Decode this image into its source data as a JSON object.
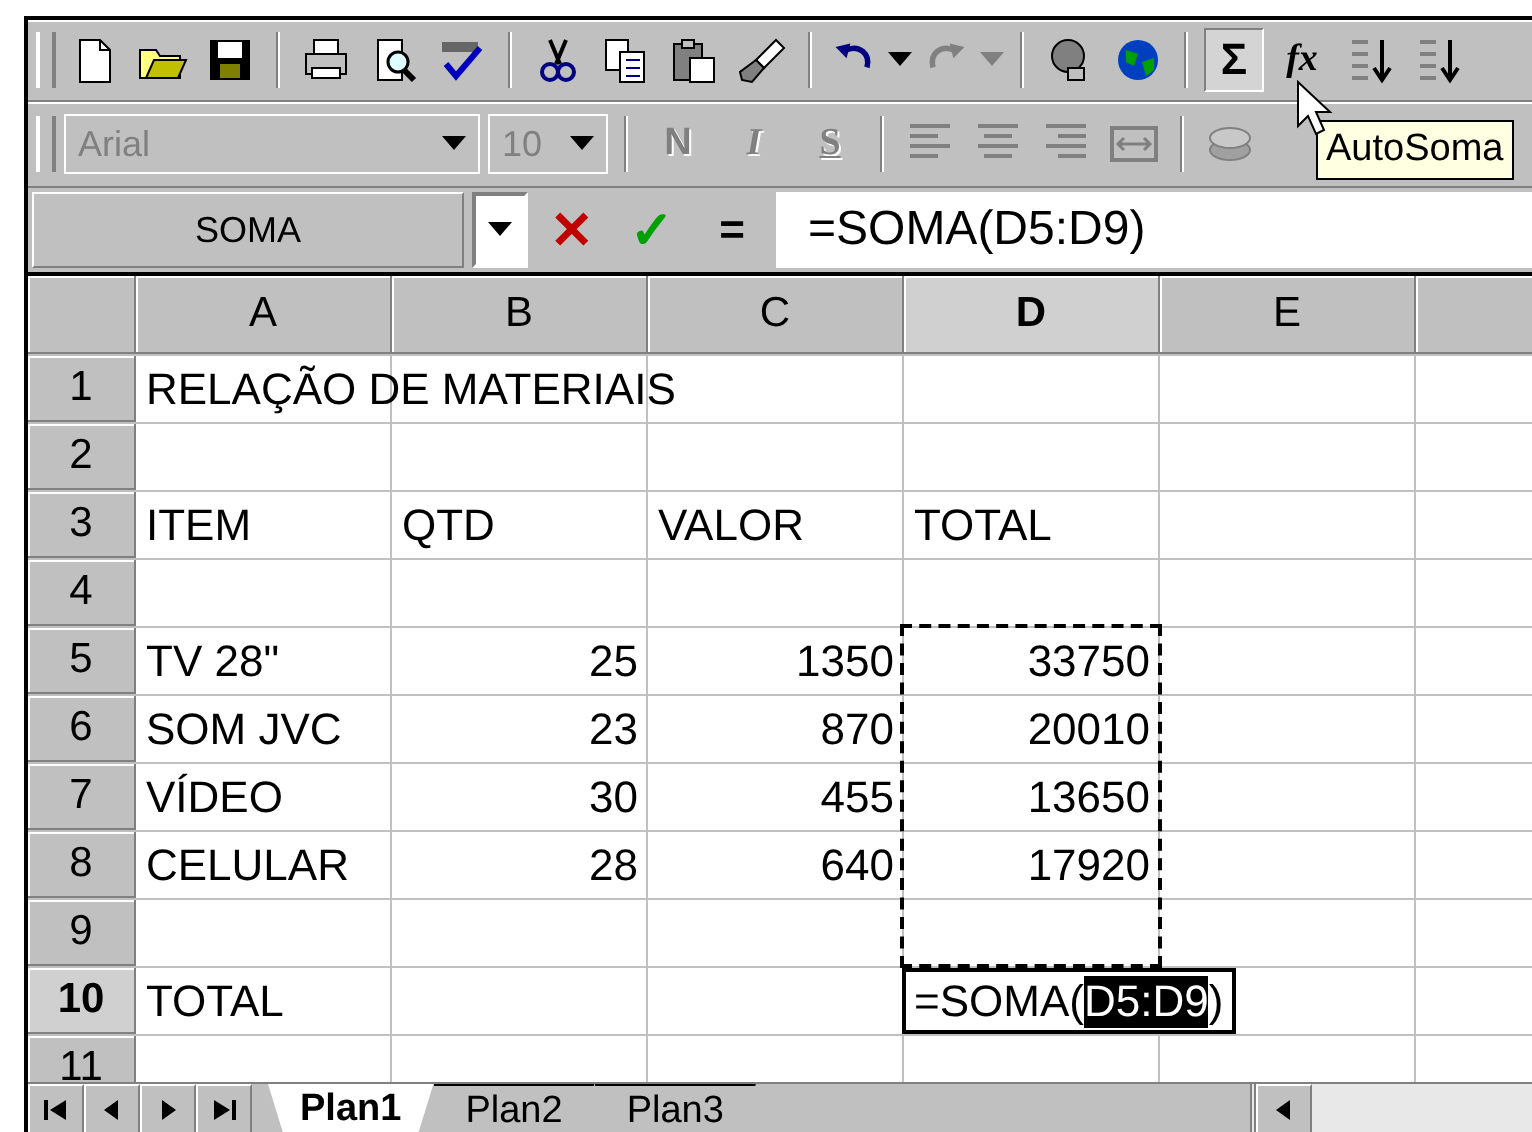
{
  "standard_toolbar": {
    "autosum_button": {
      "text": "Σ",
      "pressed": true
    },
    "function_button": {
      "text": "fx",
      "pressed": false
    }
  },
  "formatting_toolbar": {
    "font": {
      "value": "Arial",
      "disabled": true
    },
    "size": {
      "value": "10",
      "disabled": true
    },
    "style_buttons": [
      {
        "text": "N",
        "kind": "bold",
        "disabled": true
      },
      {
        "text": "I",
        "kind": "italic",
        "disabled": true
      },
      {
        "text": "S",
        "kind": "underline",
        "disabled": true
      }
    ]
  },
  "tooltip": "AutoSoma",
  "formula_bar": {
    "name_box": "SOMA",
    "cancel": "✕",
    "enter": "✓",
    "equals": "=",
    "formula": "=SOMA(D5:D9)"
  },
  "sheet": {
    "columns": [
      {
        "label": "A",
        "selected": false
      },
      {
        "label": "B",
        "selected": false
      },
      {
        "label": "C",
        "selected": false
      },
      {
        "label": "D",
        "selected": true
      },
      {
        "label": "E",
        "selected": false
      }
    ],
    "rows": [
      {
        "label": "1",
        "selected": false,
        "cells": [
          {
            "kind": "text",
            "text": "RELAÇÃO DE MATERIAIS"
          },
          {
            "kind": "empty"
          },
          {
            "kind": "empty"
          },
          {
            "kind": "empty"
          },
          {
            "kind": "empty"
          }
        ]
      },
      {
        "label": "2",
        "selected": false,
        "cells": [
          {
            "kind": "empty"
          },
          {
            "kind": "empty"
          },
          {
            "kind": "empty"
          },
          {
            "kind": "empty"
          },
          {
            "kind": "empty"
          }
        ]
      },
      {
        "label": "3",
        "selected": false,
        "cells": [
          {
            "kind": "text",
            "text": "ITEM"
          },
          {
            "kind": "text",
            "text": "QTD"
          },
          {
            "kind": "text",
            "text": "VALOR"
          },
          {
            "kind": "text",
            "text": "TOTAL"
          },
          {
            "kind": "empty"
          }
        ]
      },
      {
        "label": "4",
        "selected": false,
        "cells": [
          {
            "kind": "empty"
          },
          {
            "kind": "empty"
          },
          {
            "kind": "empty"
          },
          {
            "kind": "empty"
          },
          {
            "kind": "empty"
          }
        ]
      },
      {
        "label": "5",
        "selected": false,
        "cells": [
          {
            "kind": "text",
            "text": "TV 28\""
          },
          {
            "kind": "number",
            "text": "25"
          },
          {
            "kind": "number",
            "text": "1350"
          },
          {
            "kind": "number",
            "text": "33750",
            "marquee": true
          },
          {
            "kind": "empty"
          }
        ]
      },
      {
        "label": "6",
        "selected": false,
        "cells": [
          {
            "kind": "text",
            "text": "SOM JVC"
          },
          {
            "kind": "number",
            "text": "23"
          },
          {
            "kind": "number",
            "text": "870"
          },
          {
            "kind": "number",
            "text": "20010",
            "marquee": true
          },
          {
            "kind": "empty"
          }
        ]
      },
      {
        "label": "7",
        "selected": false,
        "cells": [
          {
            "kind": "text",
            "text": "VÍDEO"
          },
          {
            "kind": "number",
            "text": "30"
          },
          {
            "kind": "number",
            "text": "455"
          },
          {
            "kind": "number",
            "text": "13650",
            "marquee": true
          },
          {
            "kind": "empty"
          }
        ]
      },
      {
        "label": "8",
        "selected": false,
        "cells": [
          {
            "kind": "text",
            "text": "CELULAR"
          },
          {
            "kind": "number",
            "text": "28"
          },
          {
            "kind": "number",
            "text": "640"
          },
          {
            "kind": "number",
            "text": "17920",
            "marquee": true
          },
          {
            "kind": "empty"
          }
        ]
      },
      {
        "label": "9",
        "selected": false,
        "cells": [
          {
            "kind": "empty"
          },
          {
            "kind": "empty"
          },
          {
            "kind": "empty"
          },
          {
            "kind": "empty",
            "marquee": true
          },
          {
            "kind": "empty"
          }
        ]
      },
      {
        "label": "10",
        "selected": true,
        "cells": [
          {
            "kind": "text",
            "text": "TOTAL"
          },
          {
            "kind": "empty"
          },
          {
            "kind": "empty"
          },
          {
            "kind": "editing",
            "before": "=SOMA(",
            "highlight": "D5:D9",
            "after": ")"
          },
          {
            "kind": "empty"
          }
        ]
      },
      {
        "label": "11",
        "selected": false,
        "cells": [
          {
            "kind": "empty"
          },
          {
            "kind": "empty"
          },
          {
            "kind": "empty"
          },
          {
            "kind": "empty"
          },
          {
            "kind": "empty"
          }
        ]
      }
    ]
  },
  "sheet_tabs": [
    {
      "label": "Plan1",
      "selected": true
    },
    {
      "label": "Plan2",
      "selected": false
    },
    {
      "label": "Plan3",
      "selected": false
    }
  ]
}
